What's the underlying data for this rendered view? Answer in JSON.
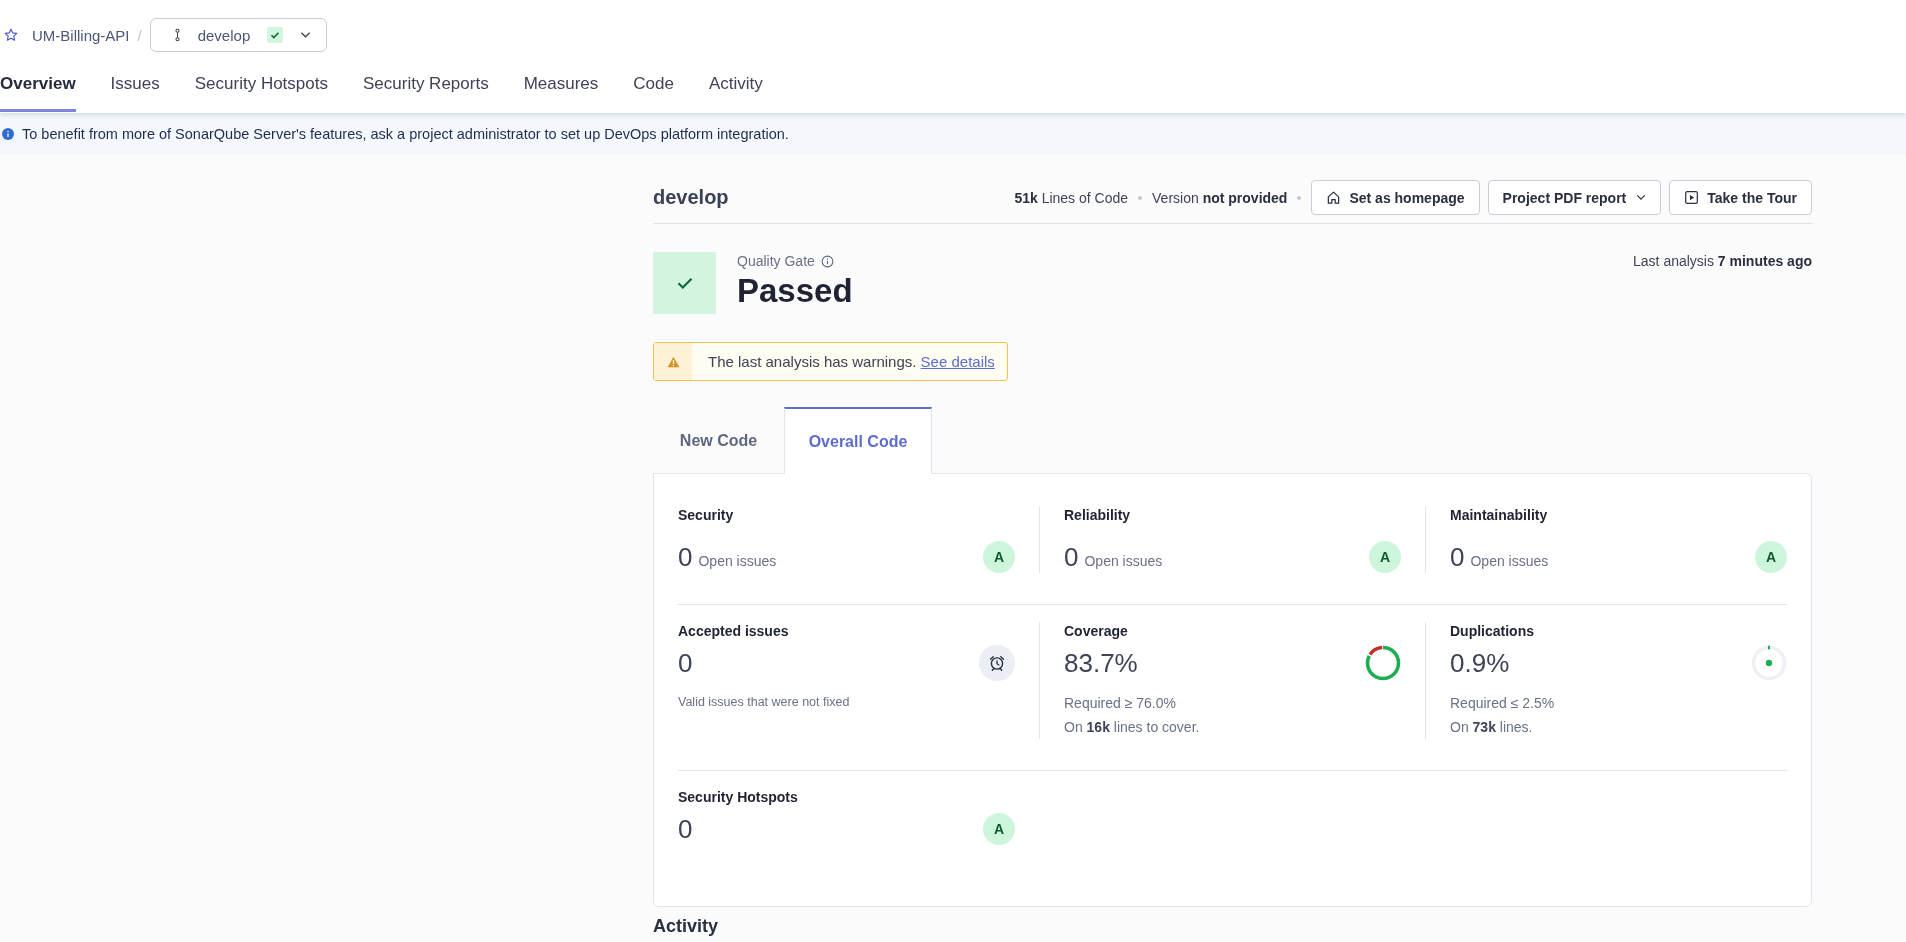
{
  "breadcrumb": {
    "project": "UM-Billing-API",
    "separator": "/",
    "branch": {
      "name": "develop",
      "passed": true
    }
  },
  "nav": [
    {
      "label": "Overview",
      "selected": true
    },
    {
      "label": "Issues",
      "selected": false
    },
    {
      "label": "Security Hotspots",
      "selected": false
    },
    {
      "label": "Security Reports",
      "selected": false
    },
    {
      "label": "Measures",
      "selected": false
    },
    {
      "label": "Code",
      "selected": false
    },
    {
      "label": "Activity",
      "selected": false
    }
  ],
  "banner": {
    "text": "To benefit from more of SonarQube Server's features, ask a project administrator to set up DevOps platform integration."
  },
  "project": {
    "title": "develop",
    "meta": [
      "**51k** Lines of Code",
      "Version **not provided**"
    ],
    "buttons": [
      {
        "kind": "home",
        "label": "Set as homepage"
      },
      {
        "kind": "dropdown",
        "label": "Project PDF report"
      },
      {
        "kind": "tour",
        "label": "Take the Tour"
      }
    ]
  },
  "quality_gate": {
    "label": "Quality Gate",
    "passed": true,
    "status_text": "Passed",
    "last_analysis": "Last analysis **7 minutes ago**"
  },
  "warning": {
    "text": "The last analysis has warnings.",
    "link": "See details"
  },
  "code_tabs": [
    {
      "label": "New Code",
      "selected": false
    },
    {
      "label": "Overall Code",
      "selected": true
    }
  ],
  "metric_rows": [
    {
      "cells": [
        {
          "kind": "rating",
          "label": "Security",
          "value": "0",
          "unit": "Open issues",
          "rating": "A"
        },
        {
          "kind": "rating",
          "label": "Reliability",
          "value": "0",
          "unit": "Open issues",
          "rating": "A"
        },
        {
          "kind": "rating",
          "label": "Maintainability",
          "value": "0",
          "unit": "Open issues",
          "rating": "A"
        }
      ]
    },
    {
      "cells": [
        {
          "kind": "accepted",
          "label": "Accepted issues",
          "value": "0",
          "note": "Valid issues that were not fixed"
        },
        {
          "kind": "coverage",
          "label": "Coverage",
          "value": "83.7%",
          "level": 0.837,
          "notes": [
            "Required ≥ 76.0%",
            "On **16k** lines to cover."
          ]
        },
        {
          "kind": "duplications",
          "label": "Duplications",
          "value": "0.9%",
          "notes": [
            "Required ≤ 2.5%",
            "On **73k** lines."
          ]
        }
      ]
    },
    {
      "cells": [
        {
          "kind": "rating",
          "label": "Security Hotspots",
          "value": "0",
          "rating": "A"
        }
      ]
    }
  ],
  "activity": {
    "title": "Activity"
  }
}
